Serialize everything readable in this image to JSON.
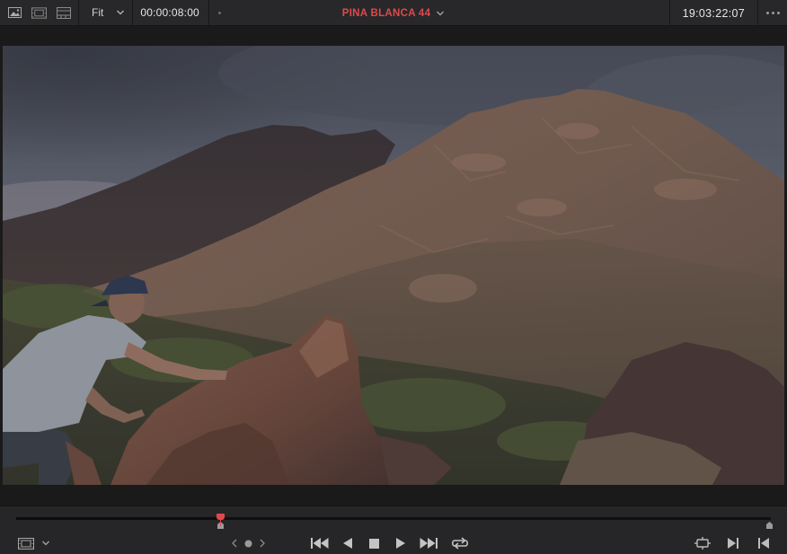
{
  "topbar": {
    "view_icons": [
      "image-view-icon",
      "film-strip-view-icon",
      "cinema-view-icon"
    ],
    "zoom": {
      "label": "Fit"
    },
    "timecode_left": "00:00:08:00",
    "clip_title": "PINA BLANCA 44",
    "timecode_right": "19:03:22:07",
    "clip_title_color": "#e2484b"
  },
  "viewer": {
    "scene": "Person in cap climbing a rock in a desert mountain landscape at dusk"
  },
  "scrubber": {
    "playhead_fraction": 0.27,
    "playhead_color": "#e2484b"
  },
  "controls": {
    "left": [
      "viewer-mode-icon",
      "chevron-down-icon"
    ],
    "jog": [
      "chevron-left-icon",
      "jog-dot-icon",
      "chevron-right-icon"
    ],
    "transport": [
      "skip-to-start-icon",
      "play-reverse-icon",
      "stop-icon",
      "play-icon",
      "skip-to-end-icon",
      "loop-icon"
    ],
    "right": [
      "match-frame-icon",
      "next-frame-icon",
      "previous-frame-icon"
    ]
  }
}
